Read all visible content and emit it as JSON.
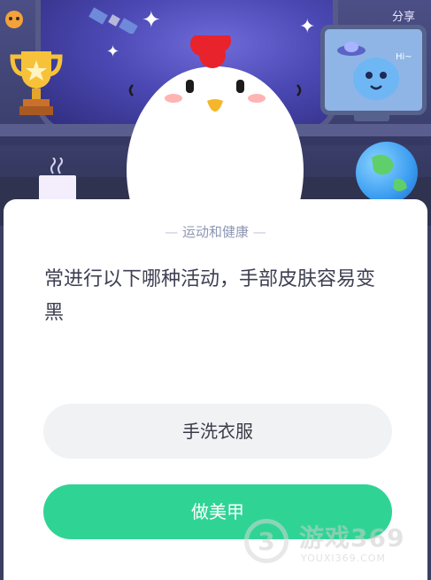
{
  "header": {
    "share_label": "分享",
    "monitor_text": "Hi~"
  },
  "card": {
    "category": "运动和健康",
    "question": "常进行以下哪种活动，手部皮肤容易变黑",
    "options": [
      {
        "label": "手洗衣服"
      },
      {
        "label": "做美甲"
      }
    ]
  },
  "watermark": {
    "title": "游戏369",
    "subtitle": "YOUXI369.COM",
    "logo_char": "3"
  },
  "colors": {
    "accent_green": "#2fd495",
    "option_gray": "#f1f2f4",
    "category_gray": "#8e96b3"
  }
}
